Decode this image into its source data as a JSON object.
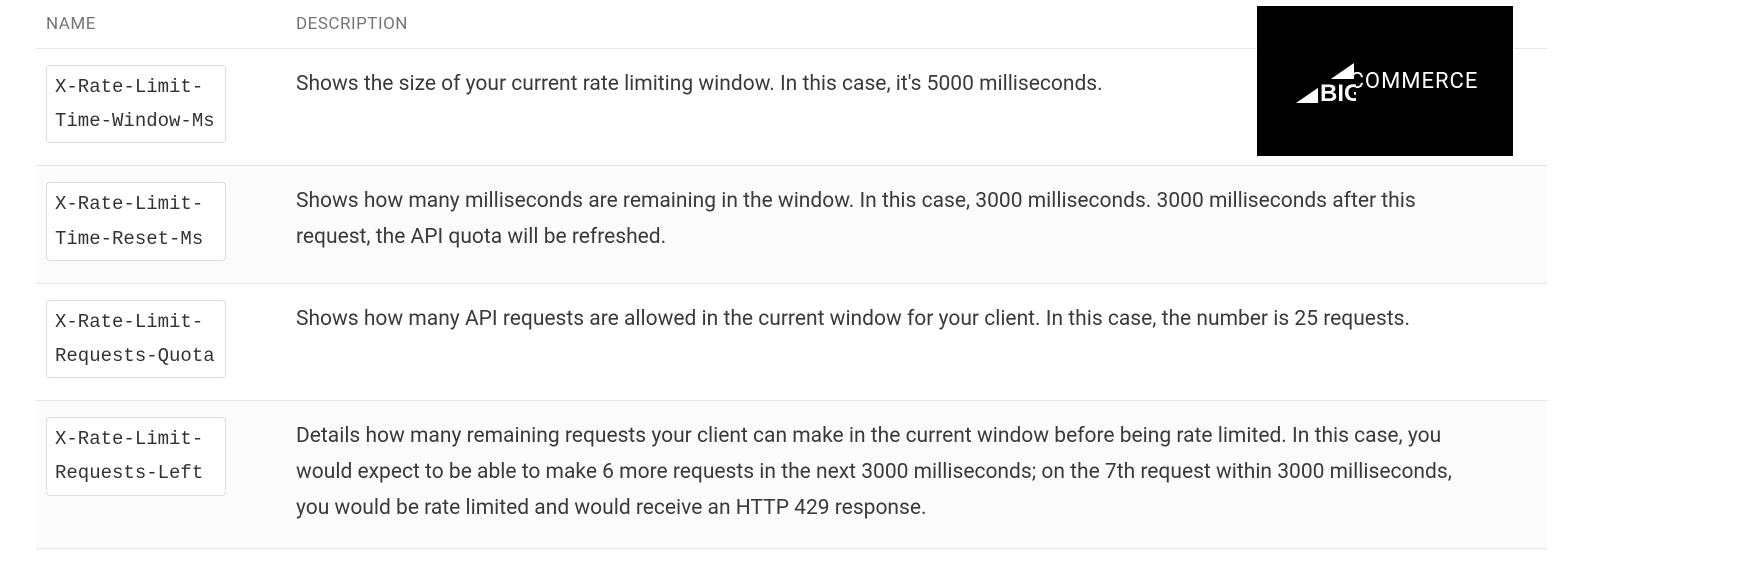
{
  "logo": {
    "big": "BIG",
    "commerce": "COMMERCE"
  },
  "columns": {
    "name": "NAME",
    "description": "DESCRIPTION"
  },
  "rows": [
    {
      "name": "X-Rate-Limit-Time-Window-Ms",
      "description": "Shows the size of your current rate limiting window. In this case, it's 5000 milliseconds."
    },
    {
      "name": "X-Rate-Limit-Time-Reset-Ms",
      "description": "Shows how many milliseconds are remaining in the window. In this case, 3000 milliseconds. 3000 milliseconds after this request, the API quota will be refreshed."
    },
    {
      "name": "X-Rate-Limit-Requests-Quota",
      "description": "Shows how many API requests are allowed in the current window for your client. In this case, the number is 25 requests."
    },
    {
      "name": "X-Rate-Limit-Requests-Left",
      "description": "Details how many remaining requests your client can make in the current window before being rate limited. In this case, you would expect to be able to make 6 more requests in the next 3000 milliseconds; on the 7th request within 3000 milliseconds, you would be rate limited and would receive an HTTP 429 response."
    }
  ]
}
